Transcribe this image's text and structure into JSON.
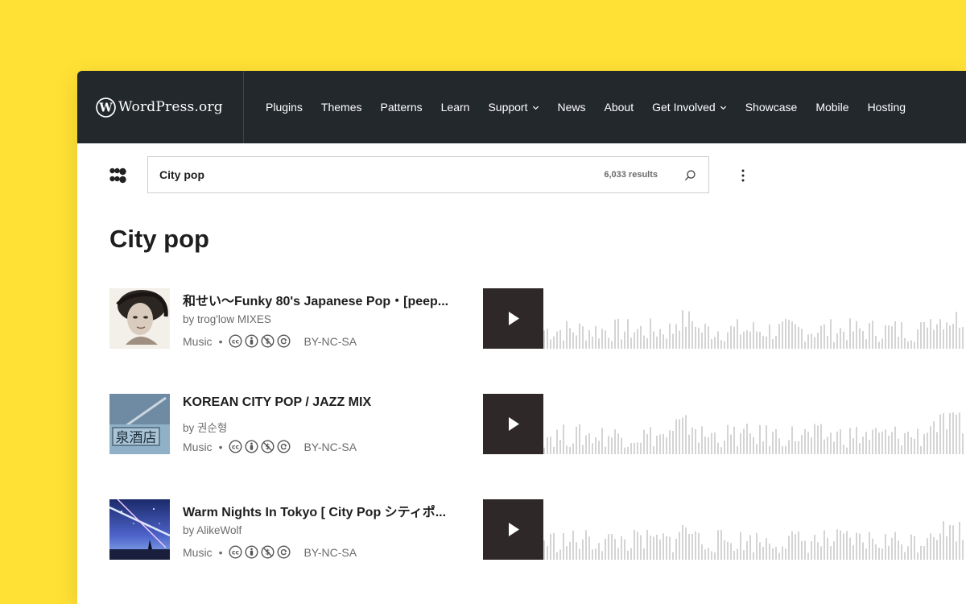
{
  "header": {
    "logo_text": "WordPress.org",
    "nav": [
      {
        "label": "Plugins",
        "dropdown": false
      },
      {
        "label": "Themes",
        "dropdown": false
      },
      {
        "label": "Patterns",
        "dropdown": false
      },
      {
        "label": "Learn",
        "dropdown": false
      },
      {
        "label": "Support",
        "dropdown": true
      },
      {
        "label": "News",
        "dropdown": false
      },
      {
        "label": "About",
        "dropdown": false
      },
      {
        "label": "Get Involved",
        "dropdown": true
      },
      {
        "label": "Showcase",
        "dropdown": false
      },
      {
        "label": "Mobile",
        "dropdown": false
      },
      {
        "label": "Hosting",
        "dropdown": false
      }
    ]
  },
  "search": {
    "value": "City pop",
    "result_count": "6,033 results"
  },
  "page_title": "City pop",
  "tracks": [
    {
      "title": "和せい〜Funky 80's Japanese Pop・[peep...",
      "by": "by trog'low MIXES",
      "category": "Music",
      "license": "BY-NC-SA"
    },
    {
      "title": "KOREAN CITY POP / JAZZ MIX",
      "by": "by 권순형",
      "category": "Music",
      "license": "BY-NC-SA"
    },
    {
      "title": "Warm Nights In Tokyo [ City Pop シティポ...",
      "by": "by AlikeWolf",
      "category": "Music",
      "license": "BY-NC-SA"
    }
  ],
  "icons": {
    "logo": "wordpress-logo-icon",
    "openverse": "openverse-menu-icon",
    "search": "search-icon",
    "menu": "more-vertical-icon",
    "play": "play-icon",
    "license": [
      "cc-icon",
      "cc-by-icon",
      "cc-nc-icon",
      "cc-sa-icon"
    ]
  },
  "colors": {
    "background": "#ffe135",
    "header": "#23282d",
    "player": "#2f2828",
    "waveform": "#d4d4d4"
  }
}
